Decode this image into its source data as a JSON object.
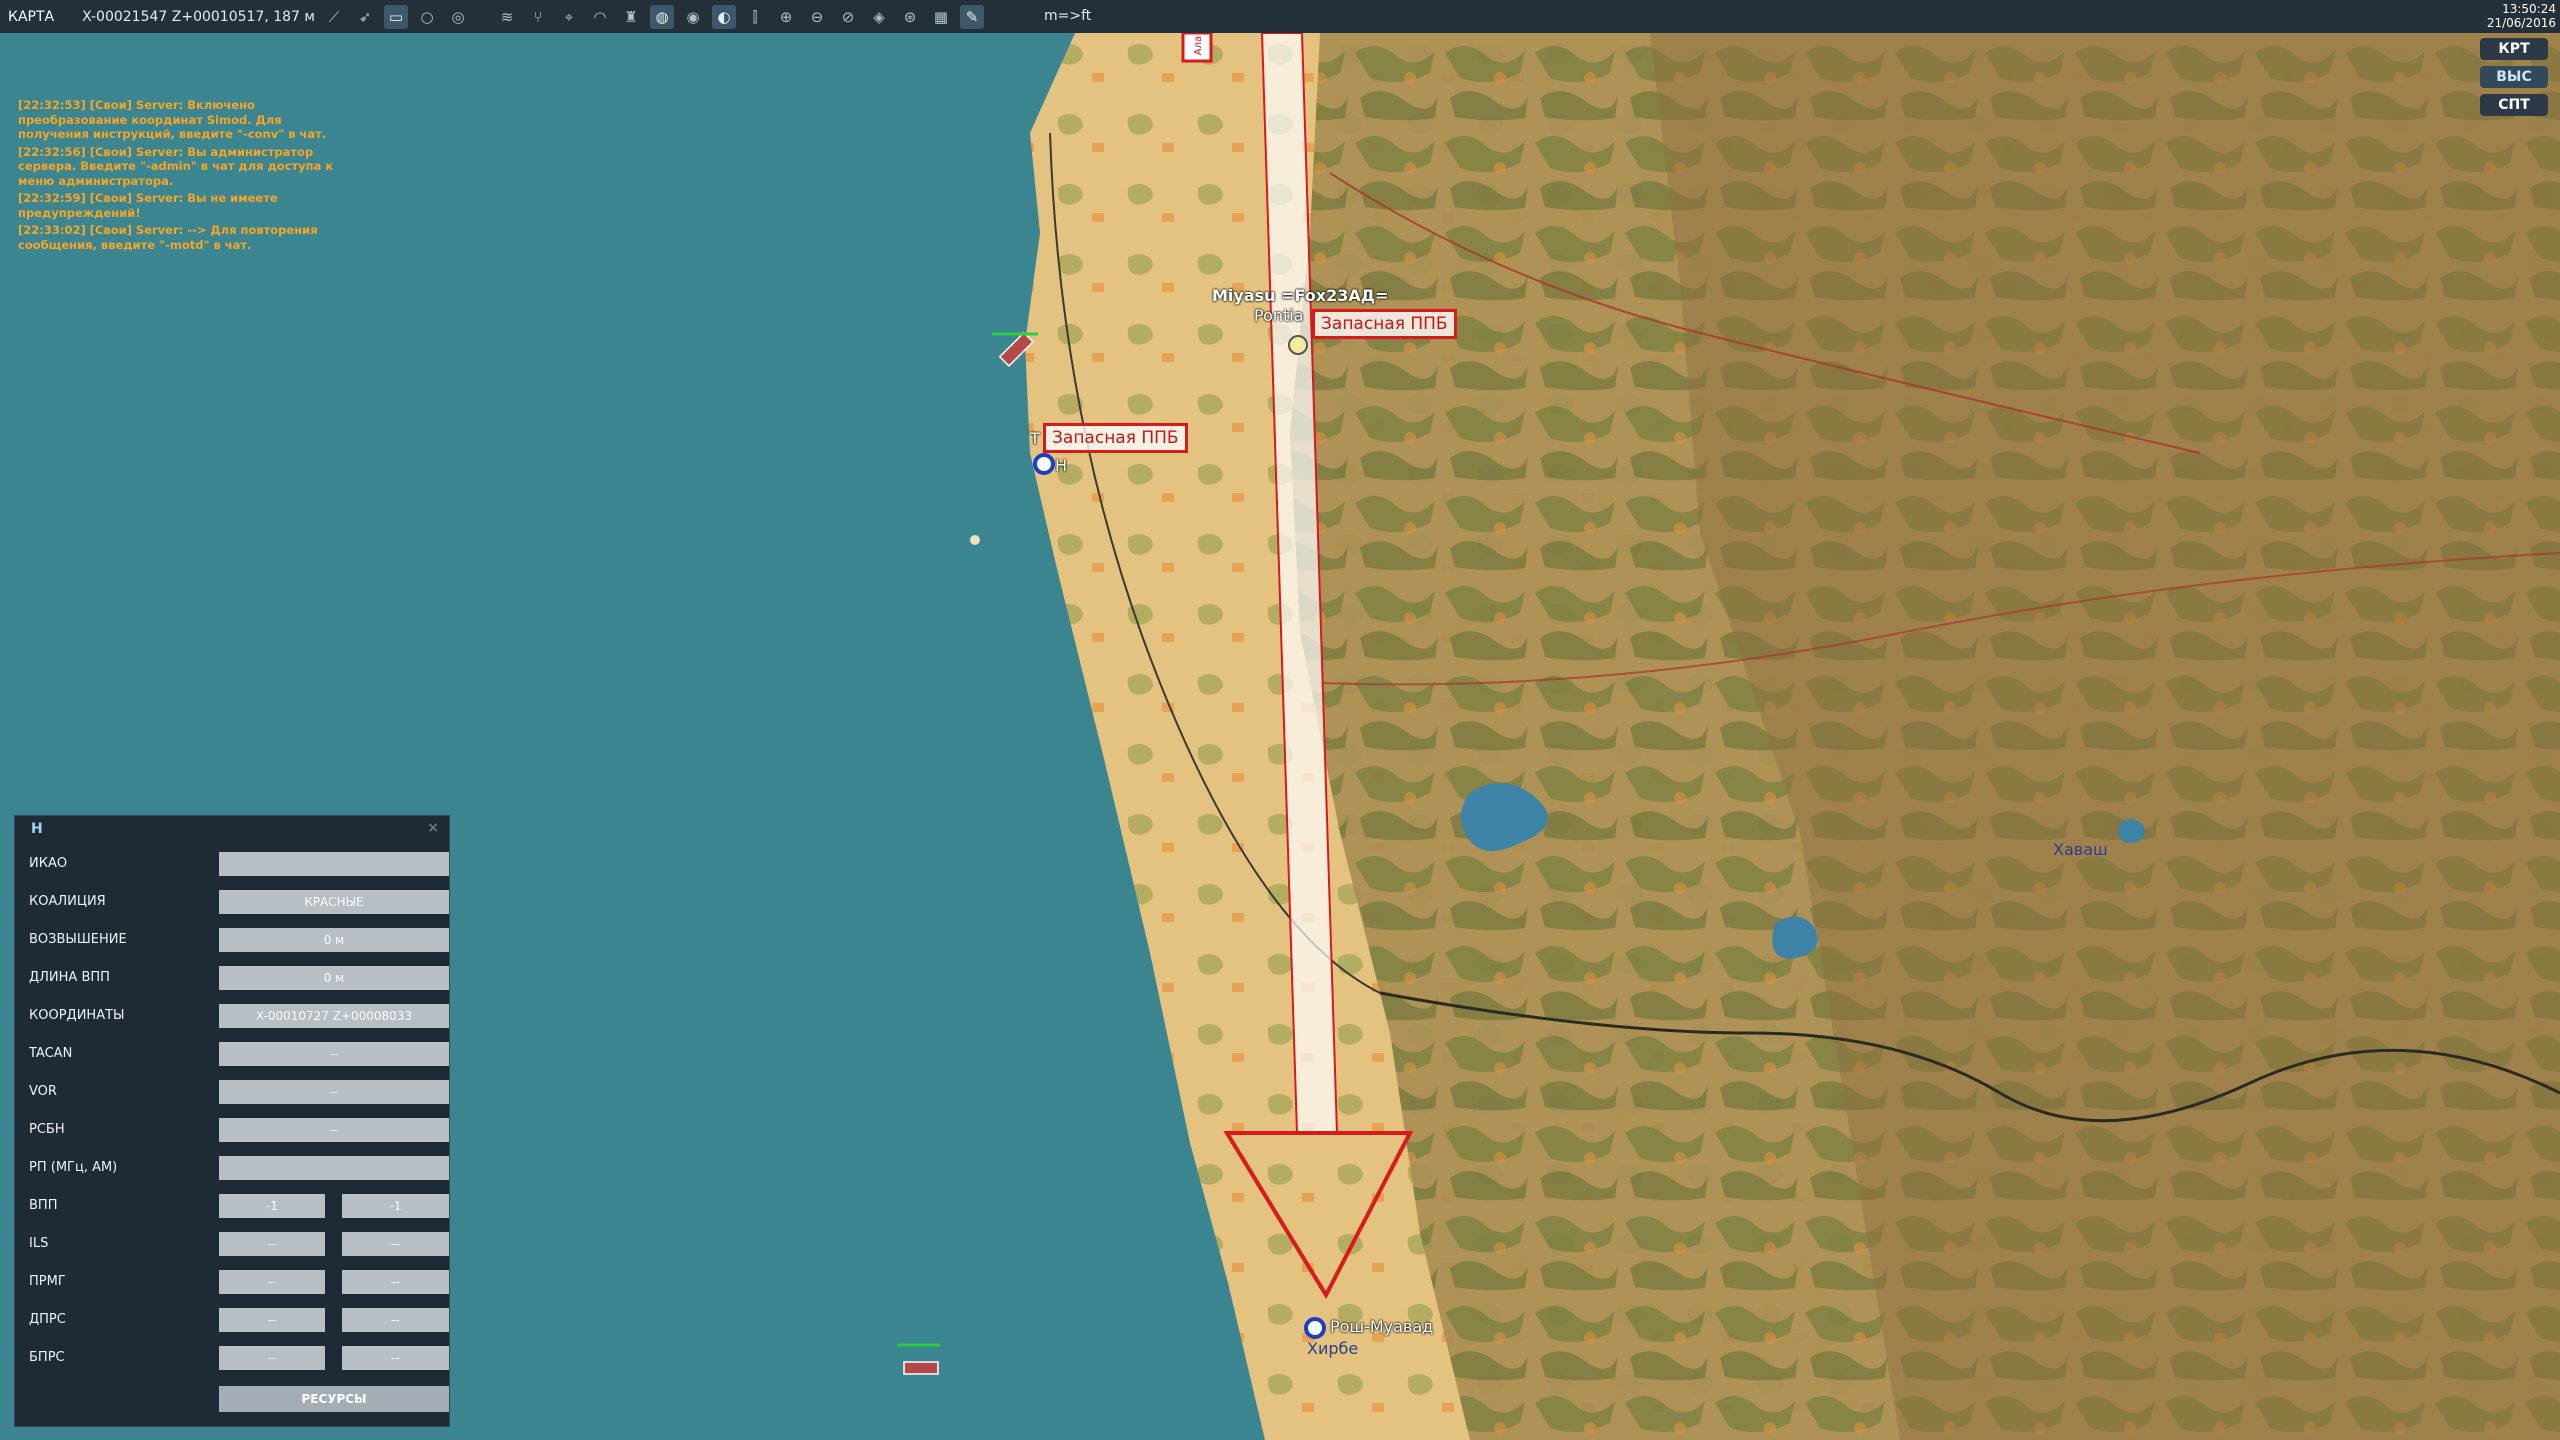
{
  "topbar": {
    "title": "КАРТА",
    "coords": "X-00021547 Z+00010517, 187 м",
    "units": "m=>ft",
    "time": "13:50:24",
    "date": "21/06/2016",
    "icons": [
      "line-icon",
      "route-icon",
      "draw-icon",
      "circle-icon",
      "layers-icon",
      "waves-icon",
      "network-icon",
      "target-icon",
      "wifi-icon",
      "tower-icon",
      "radar-icon",
      "radar2-icon",
      "radar3-icon",
      "ruler-icon",
      "zoom-in-icon",
      "zoom-out-icon",
      "zoom-search-icon",
      "compass-icon",
      "globe-icon",
      "grid-icon",
      "pencil-icon"
    ]
  },
  "side_buttons": [
    "КРТ",
    "ВЫС",
    "СПТ"
  ],
  "chat": [
    "[22:32:53] [Свои] Server: Включено преобразование координат Simod. Для получения инструкций, введите \"-conv\" в чат.",
    "[22:32:56] [Свои] Server: Вы администратор сервера. Введите \"-admin\" в чат для доступа к меню администратора.",
    "[22:32:59] [Свои] Server:  Вы не имеете предупреждений!",
    "[22:33:02] [Свои] Server: --> Для повторения сообщения, введите \"-motd\" в чат."
  ],
  "panel": {
    "title": "Н",
    "close": "×",
    "rows": [
      {
        "label": "ИКАО",
        "value": ""
      },
      {
        "label": "КОАЛИЦИЯ",
        "value": "КРАСНЫЕ"
      },
      {
        "label": "ВОЗВЫШЕНИЕ",
        "value": "0 м"
      },
      {
        "label": "ДЛИНА ВПП",
        "value": "0 м"
      },
      {
        "label": "КООРДИНАТЫ",
        "value": "X-00010727 Z+00008033"
      },
      {
        "label": "TACAN",
        "value": "--"
      },
      {
        "label": "VOR",
        "value": "--"
      },
      {
        "label": "РСБН",
        "value": "--"
      },
      {
        "label": "РП  (МГц, AM)",
        "value": ""
      }
    ],
    "pair_rows": [
      {
        "label": "ВПП",
        "v1": "-1",
        "v2": "-1"
      },
      {
        "label": "ILS",
        "v1": "--",
        "v2": "--"
      },
      {
        "label": "ПРМГ",
        "v1": "--",
        "v2": "--"
      },
      {
        "label": "ДПРС",
        "v1": "--",
        "v2": "--"
      },
      {
        "label": "БПРС",
        "v1": "--",
        "v2": "--"
      }
    ],
    "resources_button": "РЕСУРСЫ"
  },
  "map": {
    "labels": {
      "player": "Miyasu =Fox23АД=",
      "player_sub": "Pontia",
      "ppb": "Запасная ППБ",
      "town_t": "T",
      "airfield_h": "Н",
      "havash": "Хаваш",
      "rosh": "Рош-Муавад",
      "hirbe": "Хирбе",
      "top_tag": "Ала"
    },
    "colors": {
      "sea": "#3b8590",
      "sand": "#e4c27f",
      "green": "#6f7b3b",
      "red": "#d9191c"
    }
  }
}
